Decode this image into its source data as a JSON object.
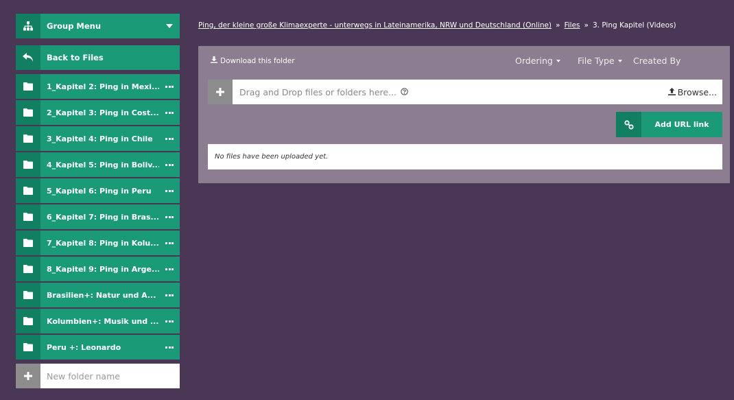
{
  "sidebar": {
    "group_menu_label": "Group Menu",
    "back_label": "Back to Files",
    "folders": [
      {
        "label": "1_Kapitel 2: Ping in Mexi..."
      },
      {
        "label": "2_Kapitel 3: Ping in Cost..."
      },
      {
        "label": "3_Kapitel 4: Ping in Chile"
      },
      {
        "label": "4_Kapitel 5: Ping in Boliv..."
      },
      {
        "label": "5_Kapitel 6: Ping in Peru"
      },
      {
        "label": "6_Kapitel 7: Ping in Bras..."
      },
      {
        "label": "7_Kapitel 8: Ping in Kolu..."
      },
      {
        "label": "8_Kapitel 9: Ping in Arge..."
      },
      {
        "label": "Brasilien+: Natur und A..."
      },
      {
        "label": "Kolumbien+: Musik und ..."
      },
      {
        "label": "Peru +: Leonardo"
      }
    ],
    "new_folder_placeholder": "New folder name"
  },
  "breadcrumb": {
    "group": "Ping, der kleine große Klimaexperte - unterwegs in Lateinamerika, NRW und Deutschland (Online)",
    "files": "Files",
    "current": "3. Ping Kapitel (Videos)",
    "separator": "»"
  },
  "panel": {
    "download_label": "Download this folder",
    "sort_ordering": "Ordering",
    "sort_filetype": "File Type",
    "sort_createdby": "Created By",
    "drop_text": "Drag and Drop files or folders here...",
    "browse_label": "Browse...",
    "add_url_label": "Add URL link",
    "empty_text": "No files have been uploaded yet."
  },
  "colors": {
    "background": "#4a3655",
    "accent": "#1b9a78",
    "accent_dark": "#127f62",
    "panel": "#8d7d90"
  }
}
